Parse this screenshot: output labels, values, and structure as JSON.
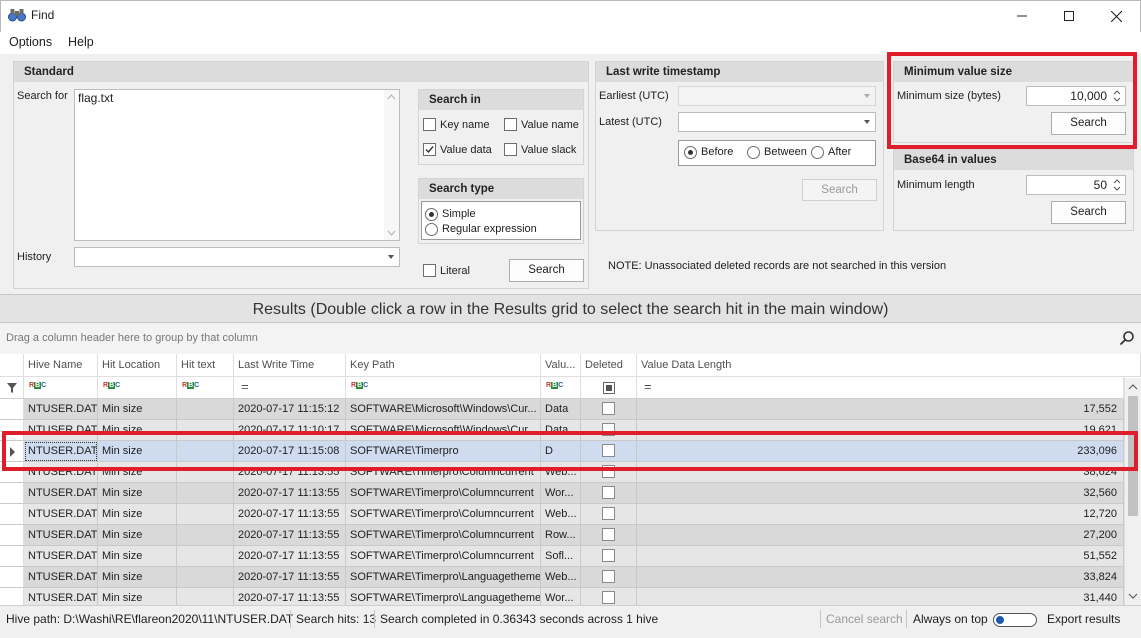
{
  "window": {
    "title": "Find",
    "minimize": "—",
    "maximize": "☐",
    "close": "✕"
  },
  "menu": [
    "Options",
    "Help"
  ],
  "standard": {
    "header": "Standard",
    "search_for_label": "Search for",
    "search_for_value": "flag.txt",
    "history_label": "History",
    "search_in": {
      "header": "Search in",
      "key_name": "Key name",
      "key_name_checked": false,
      "value_name": "Value name",
      "value_name_checked": false,
      "value_data": "Value data",
      "value_data_checked": true,
      "value_slack": "Value slack",
      "value_slack_checked": false
    },
    "search_type": {
      "header": "Search type",
      "simple": "Simple",
      "regex": "Regular expression",
      "selected": "simple"
    },
    "literal_label": "Literal",
    "search_button": "Search"
  },
  "last_write": {
    "header": "Last write timestamp",
    "earliest_label": "Earliest (UTC)",
    "latest_label": "Latest (UTC)",
    "before": "Before",
    "between": "Between",
    "after": "After",
    "selected": "before",
    "search_button": "Search"
  },
  "note": "NOTE: Unassociated deleted records are not searched in this version",
  "min_value_size": {
    "header": "Minimum value size",
    "label": "Minimum size (bytes)",
    "value": "10,000",
    "search_button": "Search"
  },
  "base64": {
    "header": "Base64 in values",
    "label": "Minimum length",
    "value": "50",
    "search_button": "Search"
  },
  "results": {
    "title": "Results (Double click a row in the Results grid to select the search hit in the main window)",
    "group_hint": "Drag a column header here to group by that column",
    "columns": [
      "Hive Name",
      "Hit Location",
      "Hit text",
      "Last Write Time",
      "Key Path",
      "Valu...",
      "Deleted",
      "Value Data Length"
    ],
    "filter_tokens": {
      "text": "RBC",
      "equals": "="
    },
    "rows": [
      [
        "NTUSER.DAT",
        "Min size",
        "",
        "2020-07-17 11:15:12",
        "SOFTWARE\\Microsoft\\Windows\\Cur...",
        "Data",
        "",
        "17,552"
      ],
      [
        "NTUSER.DAT",
        "Min size",
        "",
        "2020-07-17 11:10:17",
        "SOFTWARE\\Microsoft\\Windows\\Cur...",
        "Data",
        "",
        "19,621"
      ],
      [
        "NTUSER.DAT",
        "Min size",
        "",
        "2020-07-17 11:15:08",
        "SOFTWARE\\Timerpro",
        "D",
        "",
        "233,096"
      ],
      [
        "NTUSER.DAT",
        "Min size",
        "",
        "2020-07-17 11:13:55",
        "SOFTWARE\\Timerpro\\Columncurrent",
        "Web...",
        "",
        "38,624"
      ],
      [
        "NTUSER.DAT",
        "Min size",
        "",
        "2020-07-17 11:13:55",
        "SOFTWARE\\Timerpro\\Columncurrent",
        "Wor...",
        "",
        "32,560"
      ],
      [
        "NTUSER.DAT",
        "Min size",
        "",
        "2020-07-17 11:13:55",
        "SOFTWARE\\Timerpro\\Columncurrent",
        "Web...",
        "",
        "12,720"
      ],
      [
        "NTUSER.DAT",
        "Min size",
        "",
        "2020-07-17 11:13:55",
        "SOFTWARE\\Timerpro\\Columncurrent",
        "Row...",
        "",
        "27,200"
      ],
      [
        "NTUSER.DAT",
        "Min size",
        "",
        "2020-07-17 11:13:55",
        "SOFTWARE\\Timerpro\\Columncurrent",
        "Sofl...",
        "",
        "51,552"
      ],
      [
        "NTUSER.DAT",
        "Min size",
        "",
        "2020-07-17 11:13:55",
        "SOFTWARE\\Timerpro\\Languagetheme",
        "Web...",
        "",
        "33,824"
      ],
      [
        "NTUSER.DAT",
        "Min size",
        "",
        "2020-07-17 11:13:55",
        "SOFTWARE\\Timerpro\\Languagetheme",
        "Wor...",
        "",
        "31,440"
      ]
    ],
    "selected_row": 2
  },
  "status": {
    "hive_path": "Hive path: D:\\Washi\\RE\\flareon2020\\11\\NTUSER.DAT",
    "search_hits": "Search hits: 13",
    "completed": "Search completed in 0.36343 seconds across 1 hive",
    "cancel": "Cancel search",
    "always_on_top": "Always on top",
    "export": "Export results"
  },
  "colors": {
    "highlight": "#e01e2b",
    "selection": "#cfdcf0"
  }
}
